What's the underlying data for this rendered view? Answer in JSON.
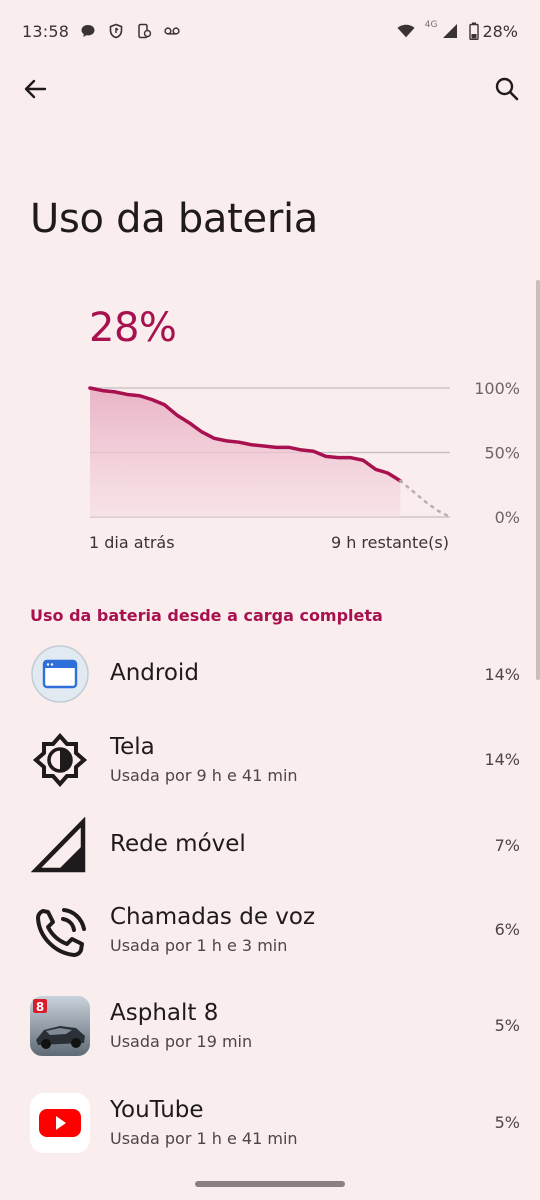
{
  "status_bar": {
    "time": "13:58",
    "network": "4G",
    "battery": "28%"
  },
  "page": {
    "title": "Uso da bateria"
  },
  "battery": {
    "level": "28%",
    "axis_start": "1 dia atrás",
    "axis_end": "9 h restante(s)"
  },
  "chart_data": {
    "type": "area",
    "y_tick_labels": [
      "100%",
      "50%",
      "0%"
    ],
    "ylim": [
      0,
      100
    ],
    "actual": [
      100,
      98,
      97,
      95,
      94,
      91,
      87,
      79,
      73,
      66,
      61,
      59,
      58,
      56,
      55,
      54,
      54,
      52,
      51,
      47,
      46,
      46,
      44,
      37,
      34,
      28
    ],
    "projected": [
      28,
      20,
      12,
      5,
      0
    ],
    "accent": "#A8114F"
  },
  "section": {
    "header": "Uso da bateria desde a carga completa"
  },
  "apps": [
    {
      "name": "Android",
      "detail": "",
      "percent": "14%",
      "icon": "android-system-icon"
    },
    {
      "name": "Tela",
      "detail": "Usada por 9 h e 41 min",
      "percent": "14%",
      "icon": "brightness-icon"
    },
    {
      "name": "Rede móvel",
      "detail": "",
      "percent": "7%",
      "icon": "cell-signal-icon"
    },
    {
      "name": "Chamadas de voz",
      "detail": "Usada por 1 h e 3 min",
      "percent": "6%",
      "icon": "phone-call-icon"
    },
    {
      "name": "Asphalt 8",
      "detail": "Usada por 19 min",
      "percent": "5%",
      "icon": "asphalt-8-icon"
    },
    {
      "name": "YouTube",
      "detail": "Usada por 1 h e 41 min",
      "percent": "5%",
      "icon": "youtube-icon"
    }
  ]
}
